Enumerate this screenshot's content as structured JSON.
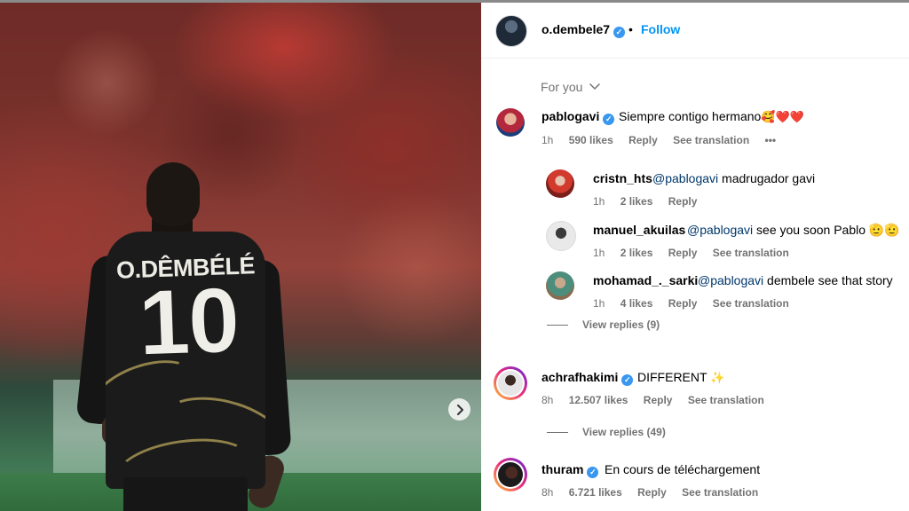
{
  "post": {
    "username": "o.dembele7",
    "follow_label": "Follow",
    "separator": "•",
    "jersey_name": "O.DÊMBÉLÉ",
    "jersey_number": "10"
  },
  "sort": {
    "label": "For you",
    "icon": "chevron-down-icon"
  },
  "comments": [
    {
      "username": "pablogavi",
      "verified": true,
      "text": "Siempre contigo hermano",
      "emoji": "🥰❤️❤️",
      "time": "1h",
      "likes": "590 likes",
      "reply": "Reply",
      "translate": "See translation",
      "more": "•••",
      "replies": [
        {
          "username": "cristn_hts",
          "mention": "@pablogavi",
          "text": " madrugador gavi",
          "time": "1h",
          "likes": "2 likes",
          "reply": "Reply"
        },
        {
          "username": "manuel_akuilas",
          "mention": "@pablogavi",
          "text": " see you soon Pablo 🫡🫡",
          "time": "1h",
          "likes": "2 likes",
          "reply": "Reply",
          "translate": "See translation"
        },
        {
          "username": "mohamad_._sarki",
          "mention": "@pablogavi",
          "text": " dembele see that story",
          "time": "1h",
          "likes": "4 likes",
          "reply": "Reply",
          "translate": "See translation"
        }
      ],
      "view_replies": "View replies (9)"
    },
    {
      "username": "achrafhakimi",
      "verified": true,
      "text": "DIFFERENT",
      "emoji": "✨",
      "time": "8h",
      "likes": "12.507 likes",
      "reply": "Reply",
      "translate": "See translation",
      "view_replies": "View replies (49)"
    },
    {
      "username": "thuram",
      "verified": true,
      "text": "En cours de téléchargement",
      "time": "8h",
      "likes": "6.721 likes",
      "reply": "Reply",
      "translate": "See translation"
    }
  ],
  "colors": {
    "link": "#0095f6",
    "verified": "#3897f0",
    "meta": "#737373",
    "mention": "#00376b"
  }
}
